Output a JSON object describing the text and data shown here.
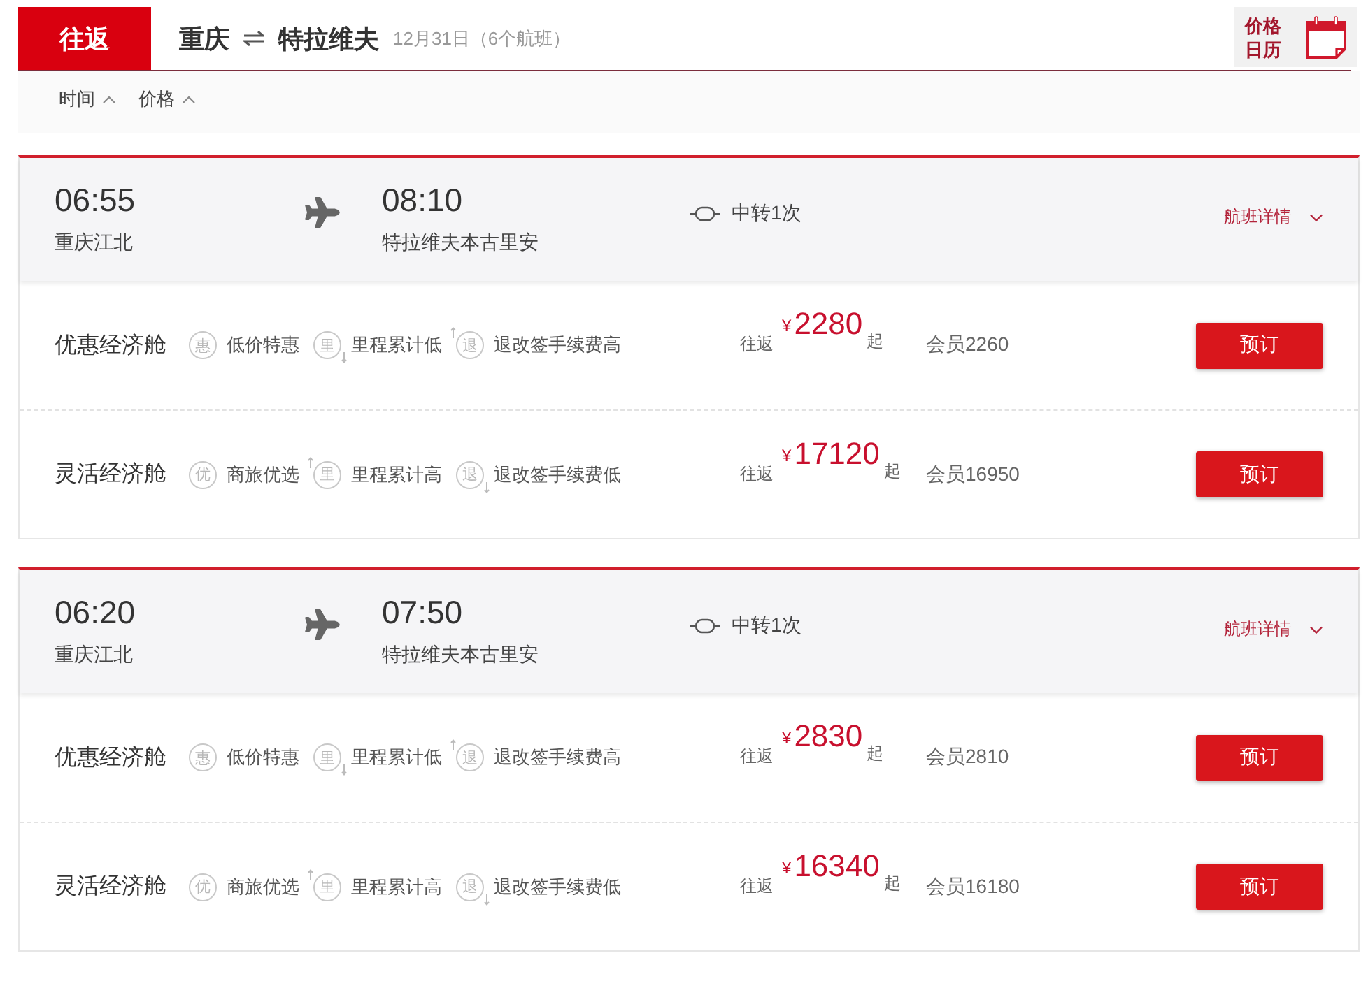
{
  "header": {
    "trip_tab": "往返",
    "origin": "重庆",
    "destination": "特拉维夫",
    "date_info": "12月31日（6个航班）",
    "calendar_button": "价格日历"
  },
  "sort_options": [
    {
      "label": "时间"
    },
    {
      "label": "价格"
    }
  ],
  "flights": [
    {
      "depart_time": "06:55",
      "depart_airport": "重庆江北",
      "arrive_time": "08:10",
      "arrive_airport": "特拉维夫本古里安",
      "stops": "中转1次",
      "details_link": "航班详情",
      "fares": [
        {
          "cabin": "优惠经济舱",
          "tags": [
            {
              "kind": "plain",
              "mark": "惠",
              "text": "低价特惠"
            },
            {
              "kind": "down",
              "mark": "里",
              "text": "里程累计低"
            },
            {
              "kind": "up",
              "mark": "退",
              "text": "退改签手续费高"
            }
          ],
          "trip_label": "往返",
          "currency": "¥",
          "price": "2280",
          "suffix": "起",
          "member_price": "会员2260",
          "button": "预订"
        },
        {
          "cabin": "灵活经济舱",
          "tags": [
            {
              "kind": "plain",
              "mark": "优",
              "text": "商旅优选"
            },
            {
              "kind": "up",
              "mark": "里",
              "text": "里程累计高"
            },
            {
              "kind": "down",
              "mark": "退",
              "text": "退改签手续费低"
            }
          ],
          "trip_label": "往返",
          "currency": "¥",
          "price": "17120",
          "suffix": "起",
          "member_price": "会员16950",
          "button": "预订"
        }
      ]
    },
    {
      "depart_time": "06:20",
      "depart_airport": "重庆江北",
      "arrive_time": "07:50",
      "arrive_airport": "特拉维夫本古里安",
      "stops": "中转1次",
      "details_link": "航班详情",
      "fares": [
        {
          "cabin": "优惠经济舱",
          "tags": [
            {
              "kind": "plain",
              "mark": "惠",
              "text": "低价特惠"
            },
            {
              "kind": "down",
              "mark": "里",
              "text": "里程累计低"
            },
            {
              "kind": "up",
              "mark": "退",
              "text": "退改签手续费高"
            }
          ],
          "trip_label": "往返",
          "currency": "¥",
          "price": "2830",
          "suffix": "起",
          "member_price": "会员2810",
          "button": "预订"
        },
        {
          "cabin": "灵活经济舱",
          "tags": [
            {
              "kind": "plain",
              "mark": "优",
              "text": "商旅优选"
            },
            {
              "kind": "up",
              "mark": "里",
              "text": "里程累计高"
            },
            {
              "kind": "down",
              "mark": "退",
              "text": "退改签手续费低"
            }
          ],
          "trip_label": "往返",
          "currency": "¥",
          "price": "16340",
          "suffix": "起",
          "member_price": "会员16180",
          "button": "预订"
        }
      ]
    }
  ]
}
